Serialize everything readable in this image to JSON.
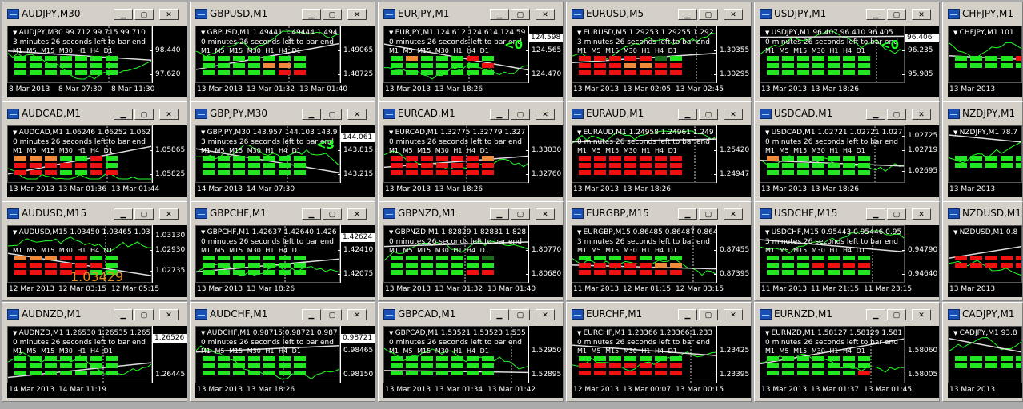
{
  "desktop": {
    "windows": [
      {
        "title": "AUDJPY,M30",
        "caption": "AUDJPY,M30  99.712 99.715 99.710",
        "message": "3 minutes 26 seconds left to bar end",
        "timeframes": "M1 M5 M15 M30 H1 H4 D1",
        "rows": [
          "ggggggg",
          "ggggggg",
          "ggggggg"
        ],
        "prices": [
          "98.440",
          "97.620"
        ],
        "badge": "",
        "dates": [
          "8 Mar 2013",
          "8 Mar 07:30",
          "8 Mar 11:30"
        ],
        "extra": ""
      },
      {
        "title": "GBPUSD,M1",
        "caption": "GBPUSD,M1  1.49441 1.49444 1.494",
        "message": "0 minutes 26 seconds left to bar end",
        "timeframes": "M1 M5 M15 M30 H1 H4 D1",
        "rows": [
          "ggggggg",
          "ggggoog",
          "gggggrr"
        ],
        "prices": [
          "1.49065",
          "1.48725"
        ],
        "badge": "",
        "dates": [
          "13 Mar 2013",
          "13 Mar 01:32",
          "13 Mar 01:40"
        ],
        "extra": ""
      },
      {
        "title": "EURJPY,M1",
        "caption": "EURJPY,M1  124.612 124.614 124.59",
        "message": "0 minutes 26 seconds left to bar end",
        "timeframes": "M1 M5 M15 M30 H1 H4 D1",
        "rows": [
          "gogggrg",
          "ggggggr",
          "ggggggg"
        ],
        "prices": [
          "124.565",
          "124.470"
        ],
        "badge": "124.598",
        "dates": [
          "13 Mar 2013",
          "13 Mar 18:26"
        ],
        "extra": "<0"
      },
      {
        "title": "EURUSD,M5",
        "caption": "EURUSD,M5  1.29253 1.29255 1.292",
        "message": "3 minutes 26 seconds left to bar end",
        "timeframes": "M1 M5 M15 M30 H1 H4 D1",
        "rows": [
          "rrrrrdg",
          "rrroorr",
          "rrrrrrr"
        ],
        "prices": [
          "1.30355",
          "1.30295"
        ],
        "badge": "",
        "dates": [
          "13 Mar 2013",
          "13 Mar 02:05",
          "13 Mar 02:45"
        ],
        "extra": ""
      },
      {
        "title": "USDJPY,M1",
        "caption": "USDJPY,M1  96.407 96.410 96.405",
        "message": "0 minutes 26 seconds left to bar end",
        "timeframes": "M1 M5 M15 M30 H1 H4 D1",
        "rows": [
          "ggggggg",
          "ggggggg",
          "ggggggg"
        ],
        "prices": [
          "96.235",
          "95.985"
        ],
        "badge": "96.406",
        "dates": [
          "13 Mar 2013",
          "13 Mar 18:26"
        ],
        "extra": "<0"
      },
      {
        "title": "CHFJPY,M1",
        "caption": "CHFJPY,M1  101",
        "message": "",
        "timeframes": "",
        "rows": [
          "gggg",
          "rrrg",
          "gggg"
        ],
        "prices": [],
        "badge": "",
        "dates": [
          "13 Mar 2013"
        ],
        "extra": ""
      },
      {
        "title": "AUDCAD,M1",
        "caption": "AUDCAD,M1  1.06246 1.06252 1.062",
        "message": "0 minutes 26 seconds left to bar end",
        "timeframes": "M1 M5 M15 M30 H1 H4 D1",
        "rows": [
          "oooggrg",
          "rrrrrrg",
          "rrrggrr"
        ],
        "prices": [
          "1.05865",
          "1.05825"
        ],
        "badge": "",
        "dates": [
          "13 Mar 2013",
          "13 Mar 01:36",
          "13 Mar 01:44"
        ],
        "extra": ""
      },
      {
        "title": "GBPJPY,M30",
        "caption": "GBPJPY,M30  143.957 144.103 143.9",
        "message": "3 minutes 26 seconds left to bar end",
        "timeframes": "M1 M5 M15 M30 H1 H4 D1",
        "rows": [
          "ggggggg",
          "ggggggg",
          "ggggggg"
        ],
        "prices": [
          "143.815",
          "143.215"
        ],
        "badge": "144.061",
        "dates": [
          "14 Mar 2013",
          "14 Mar 07:30"
        ],
        "extra": "<3"
      },
      {
        "title": "EURCAD,M1",
        "caption": "EURCAD,M1  1.32775 1.32779 1.327",
        "message": "0 minutes 26 seconds left to bar end",
        "timeframes": "M1 M5 M15 M30 H1 H4 D1",
        "rows": [
          "rrrrrro",
          "rrrrrrr",
          "rrrrrrr"
        ],
        "prices": [
          "1.33030",
          "1.32760"
        ],
        "badge": "",
        "dates": [
          "13 Mar 2013",
          "13 Mar 18:26"
        ],
        "extra": ""
      },
      {
        "title": "EURAUD,M1",
        "caption": "EURAUD,M1  1.24958 1.24961 1.249",
        "message": "0 minutes 26 seconds left to bar end",
        "timeframes": "M1 M5 M15 M30 H1 H4 D1",
        "rows": [
          "rrrrrrr",
          "rrrrrrr",
          "rrrrrrr"
        ],
        "prices": [
          "1.25420",
          "1.24947"
        ],
        "badge": "",
        "dates": [
          "13 Mar 2013",
          "13 Mar 18:26"
        ],
        "extra": ""
      },
      {
        "title": "USDCAD,M1",
        "caption": "USDCAD,M1  1.02721 1.02721 1.027",
        "message": "0 minutes 26 seconds left to bar end",
        "timeframes": "M1 M5 M15 M30 H1 H4 D1",
        "rows": [
          "ogggggg",
          "ggggggg",
          "ggggggg"
        ],
        "prices": [
          "1.02725",
          "1.02719",
          "1.02695"
        ],
        "badge": "",
        "dates": [
          "13 Mar 2013",
          "13 Mar 18:26"
        ],
        "extra": ""
      },
      {
        "title": "NZDJPY,M1",
        "caption": "NZDJPY,M1  78.7",
        "message": "",
        "timeframes": "",
        "rows": [
          "gggg",
          "gggg",
          "gggg"
        ],
        "prices": [],
        "badge": "",
        "dates": [
          "13 Mar 2013"
        ],
        "extra": ""
      },
      {
        "title": "AUDUSD,M15",
        "caption": "AUDUSD,M15  1.03450 1.03465 1.03",
        "message": "",
        "timeframes": "M1 M5 M15 M30 H1 H4 D1",
        "rows": [
          "ooorrgg",
          "rrrrrrg",
          "rrrrrgg"
        ],
        "prices": [
          "1.03130",
          "1.02930",
          "1.02735"
        ],
        "badge": "",
        "dates": [
          "12 Mar 2013",
          "12 Mar 03:15",
          "12 Mar 05:15"
        ],
        "extra": "1.03429"
      },
      {
        "title": "GBPCHF,M1",
        "caption": "GBPCHF,M1  1.42637 1.42640 1.426",
        "message": "0 minutes 26 seconds left to bar end",
        "timeframes": "M1 M5 M15 M30 H1 H4 D1",
        "rows": [
          "ggggggg",
          "ggggggg",
          "ggggggg"
        ],
        "prices": [
          "1.42410",
          "1.42075"
        ],
        "badge": "1.42624",
        "dates": [
          "13 Mar 2013",
          "13 Mar 18:26"
        ],
        "extra": ""
      },
      {
        "title": "GBPNZD,M1",
        "caption": "GBPNZD,M1  1.82829 1.82831 1.828",
        "message": "0 minutes 26 seconds left to bar end",
        "timeframes": "M1 M5 M15 M30 H1 H4 D1",
        "rows": [
          "ggggggd",
          "ggggggg",
          "gggggrr"
        ],
        "prices": [
          "1.80770",
          "1.80680"
        ],
        "badge": "",
        "dates": [
          "13 Mar 2013",
          "13 Mar 01:32",
          "13 Mar 01:40"
        ],
        "extra": ""
      },
      {
        "title": "EURGBP,M15",
        "caption": "EURGBP,M15  0.86485 0.86487 0.864",
        "message": "3 minutes 26 seconds left to bar end",
        "timeframes": "M1 M5 M15 M30 H1 H4 D1",
        "rows": [
          "gggrggg",
          "rrrrroo",
          "rrrrrrr"
        ],
        "prices": [
          "0.87455",
          "0.87395"
        ],
        "badge": "",
        "dates": [
          "11 Mar 2013",
          "12 Mar 01:15",
          "12 Mar 03:15"
        ],
        "extra": ""
      },
      {
        "title": "USDCHF,M15",
        "caption": "USDCHF,M15  0.95443 0.95446 0.95",
        "message": "3 minutes 26 seconds left to bar end",
        "timeframes": "M1 M5 M15 M30 H1 H4 D1",
        "rows": [
          "ggggggg",
          "gggrrrr",
          "ggggggg"
        ],
        "prices": [
          "0.94790",
          "0.94640"
        ],
        "badge": "",
        "dates": [
          "11 Mar 2013",
          "11 Mar 21:15",
          "11 Mar 23:15"
        ],
        "extra": ""
      },
      {
        "title": "NZDUSD,M1",
        "caption": "NZDUSD,M1  0.8",
        "message": "",
        "timeframes": "",
        "rows": [
          "rrrr",
          "rrrr",
          "rrrr"
        ],
        "prices": [],
        "badge": "",
        "dates": [
          "13 Mar 2013"
        ],
        "extra": ""
      },
      {
        "title": "AUDNZD,M1",
        "caption": "AUDNZD,M1  1.26530 1.26535 1.265",
        "message": "0 minutes 26 seconds left to bar end",
        "timeframes": "M1 M5 M15 M30 H1 H4 D1",
        "rows": [
          "ggggggg",
          "ggggggg",
          "ggggggg"
        ],
        "prices": [
          "1.26445"
        ],
        "badge": "1.26526",
        "dates": [
          "14 Mar 2013",
          "14 Mar 11:19"
        ],
        "extra": ""
      },
      {
        "title": "AUDCHF,M1",
        "caption": "AUDCHF,M1  0.98715 0.98721 0.987",
        "message": "0 minutes 26 seconds left to bar end",
        "timeframes": "M1 M5 M15 M30 H1 H4 D1",
        "rows": [
          "ggggggg",
          "ggggggg",
          "ggggggg"
        ],
        "prices": [
          "0.98465",
          "0.98150"
        ],
        "badge": "0.98721",
        "dates": [
          "13 Mar 2013",
          "13 Mar 18:26"
        ],
        "extra": ""
      },
      {
        "title": "GBPCAD,M1",
        "caption": "GBPCAD,M1  1.53521 1.53523 1.535",
        "message": "0 minutes 26 seconds left to bar end",
        "timeframes": "M1 M5 M15 M30 H1 H4 D1",
        "rows": [
          "ggggggg",
          "ggggggg",
          "ggggggg"
        ],
        "prices": [
          "1.52950",
          "1.52895"
        ],
        "badge": "",
        "dates": [
          "13 Mar 2013",
          "13 Mar 01:34",
          "13 Mar 01:42"
        ],
        "extra": ""
      },
      {
        "title": "EURCHF,M1",
        "caption": "EURCHF,M1  1.23366 1.23366 1.233",
        "message": "0 minutes 26 seconds left to bar end",
        "timeframes": "M1 M5 M15 M30 H1 H4 D1",
        "rows": [
          "ggggggg",
          "rrrrrrr",
          "rrrrrrr"
        ],
        "prices": [
          "1.23425",
          "1.23395"
        ],
        "badge": "",
        "dates": [
          "12 Mar 2013",
          "13 Mar 00:07",
          "13 Mar 00:15"
        ],
        "extra": ""
      },
      {
        "title": "EURNZD,M1",
        "caption": "EURNZD,M1  1.58127 1.58129 1.581",
        "message": "0 minutes 26 seconds left to bar end",
        "timeframes": "M1 M5 M15 M30 H1 H4 D1",
        "rows": [
          "ggggggg",
          "ggggggg",
          "ggggggr"
        ],
        "prices": [
          "1.58060",
          "1.58005"
        ],
        "badge": "",
        "dates": [
          "13 Mar 2013",
          "13 Mar 01:37",
          "13 Mar 01:45"
        ],
        "extra": ""
      },
      {
        "title": "CADJPY,M1",
        "caption": "CADJPY,M1  93.8",
        "message": "",
        "timeframes": "",
        "rows": [
          "gggg",
          "gggg",
          "gggg"
        ],
        "prices": [],
        "badge": "",
        "dates": [
          "13 Mar 2013"
        ],
        "extra": ""
      }
    ],
    "buttons": {
      "minimize": "▁",
      "maximize": "▢",
      "close": "✕"
    }
  }
}
